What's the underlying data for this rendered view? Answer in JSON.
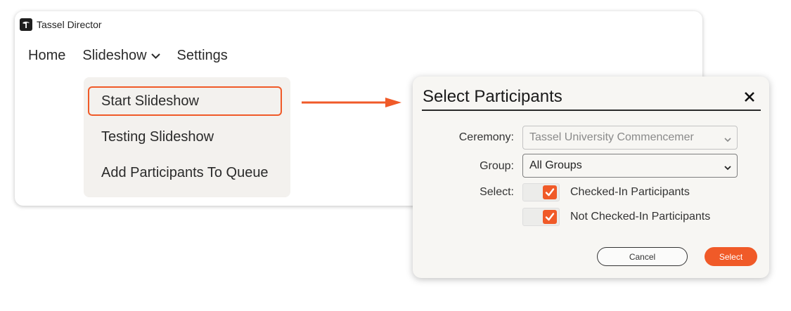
{
  "app": {
    "title": "Tassel Director"
  },
  "menubar": {
    "items": [
      {
        "label": "Home"
      },
      {
        "label": "Slideshow"
      },
      {
        "label": "Settings"
      }
    ]
  },
  "dropdown": {
    "items": [
      {
        "label": "Start Slideshow",
        "highlighted": true
      },
      {
        "label": "Testing Slideshow",
        "highlighted": false
      },
      {
        "label": "Add Participants To Queue",
        "highlighted": false
      }
    ]
  },
  "dialog": {
    "title": "Select Participants",
    "close_icon": "close-icon",
    "fields": {
      "ceremony_label": "Ceremony:",
      "ceremony_value": "Tassel University Commencemer",
      "ceremony_disabled": true,
      "group_label": "Group:",
      "group_value": "All Groups",
      "select_label": "Select:"
    },
    "checkboxes": [
      {
        "label": "Checked-In Participants",
        "checked": true
      },
      {
        "label": "Not Checked-In Participants",
        "checked": true
      }
    ],
    "buttons": {
      "cancel": "Cancel",
      "select": "Select"
    }
  },
  "colors": {
    "accent": "#f05a28",
    "dropdown_bg": "#f3f1ee",
    "dialog_bg": "#f7f6f3"
  }
}
